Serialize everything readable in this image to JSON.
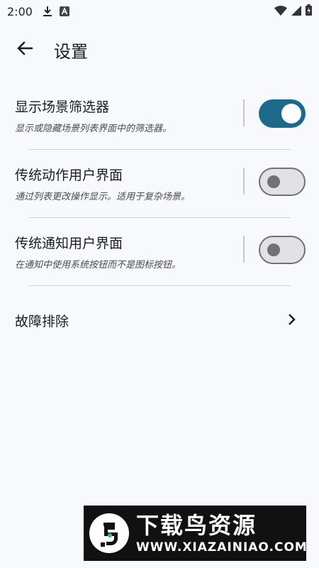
{
  "status_bar": {
    "time": "2:00",
    "icons": [
      "download-icon",
      "a-badge-icon",
      "wifi-icon",
      "signal-icon",
      "battery-icon"
    ]
  },
  "app_bar": {
    "back_icon": "arrow-left-icon",
    "title": "设置"
  },
  "settings": [
    {
      "title": "显示场景筛选器",
      "description": "显示或隐藏场景列表界面中的筛选器。",
      "enabled": true
    },
    {
      "title": "传统动作用户界面",
      "description": "通过列表更改操作显示。适用于复杂场景。",
      "enabled": false
    },
    {
      "title": "传统通知用户界面",
      "description": "在通知中使用系统按钮而不是图标按钮。",
      "enabled": false
    }
  ],
  "troubleshoot": {
    "label": "故障排除",
    "icon": "chevron-right-icon"
  },
  "watermark": {
    "title": "下载鸟资源",
    "url": "WWW.XIAZAINIAO.COM"
  },
  "colors": {
    "background": "#f8f9fc",
    "switch_on": "#1b6a89",
    "switch_off_track": "#e2e2e6",
    "switch_off_outline": "#6f7378"
  }
}
